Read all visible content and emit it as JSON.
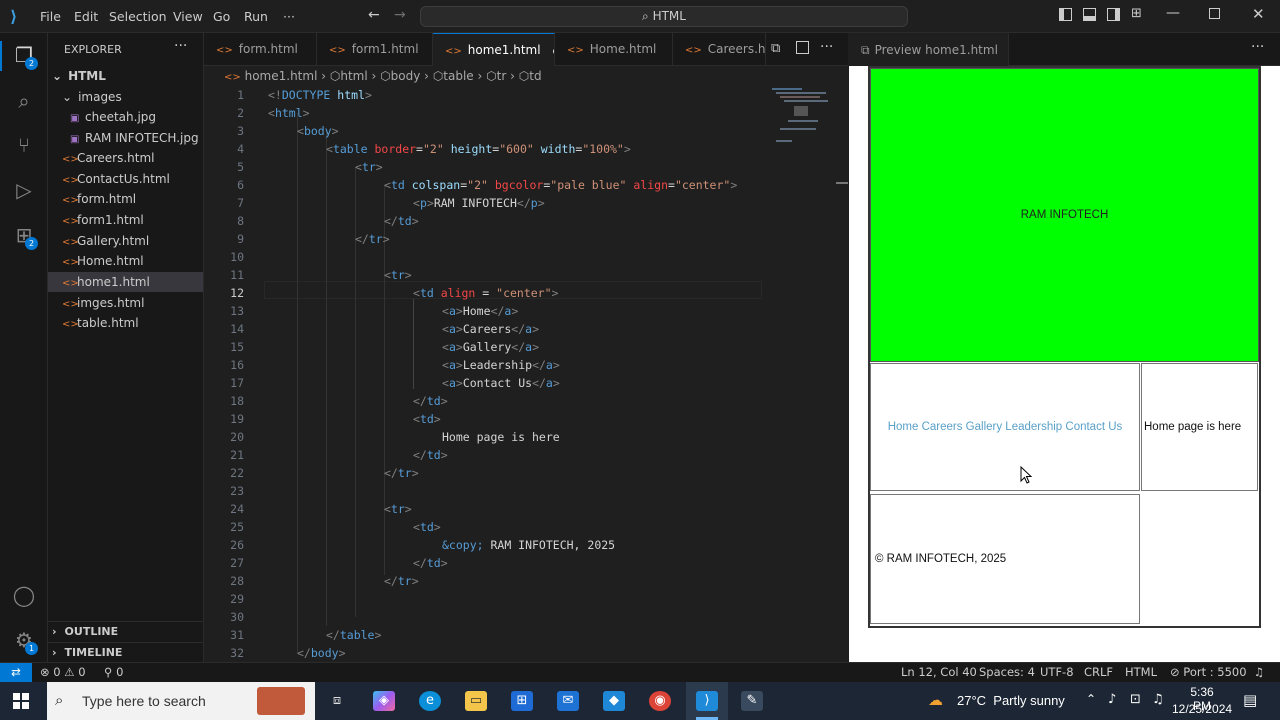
{
  "menu": [
    "File",
    "Edit",
    "Selection",
    "View",
    "Go",
    "Run",
    "···"
  ],
  "search_text": "HTML",
  "explorer": {
    "title": "EXPLORER",
    "root": "HTML",
    "items": [
      {
        "label": "images",
        "type": "folder"
      },
      {
        "label": "cheetah.jpg",
        "type": "image"
      },
      {
        "label": "RAM INFOTECH.jpg",
        "type": "image"
      },
      {
        "label": "Careers.html",
        "type": "html"
      },
      {
        "label": "ContactUs.html",
        "type": "html"
      },
      {
        "label": "form.html",
        "type": "html"
      },
      {
        "label": "form1.html",
        "type": "html"
      },
      {
        "label": "Gallery.html",
        "type": "html"
      },
      {
        "label": "Home.html",
        "type": "html"
      },
      {
        "label": "home1.html",
        "type": "html"
      },
      {
        "label": "imges.html",
        "type": "html"
      },
      {
        "label": "table.html",
        "type": "html"
      }
    ],
    "outline": "OUTLINE",
    "timeline": "TIMELINE"
  },
  "tabs": [
    "form.html",
    "form1.html",
    "home1.html",
    "Home.html",
    "Careers.htm"
  ],
  "breadcrumb": [
    "home1.html",
    "html",
    "body",
    "table",
    "tr",
    "td"
  ],
  "preview_tab": "Preview home1.html",
  "preview": {
    "title_text": "RAM INFOTECH",
    "nav_links": "Home Careers Gallery Leadership Contact Us",
    "content": "Home page is here",
    "footer": "© RAM INFOTECH, 2025",
    "banner_color": "#00ff00"
  },
  "status": {
    "errors": "0",
    "warnings": "0",
    "info": "0",
    "cursor": "Ln 12, Col 40",
    "spaces": "Spaces: 4",
    "encoding": "UTF-8",
    "eol": "CRLF",
    "language": "HTML",
    "port": "Port : 5500"
  },
  "taskbar": {
    "search_placeholder": "Type here to search",
    "weather": "27°C  Partly sunny",
    "time": "5:36 PM",
    "date": "12/25/2024"
  },
  "code_lines": [
    "1",
    "2",
    "3",
    "4",
    "5",
    "6",
    "7",
    "8",
    "9",
    "10",
    "11",
    "12",
    "13",
    "14",
    "15",
    "16",
    "17",
    "18",
    "19",
    "20",
    "21",
    "22",
    "23",
    "24",
    "25",
    "26",
    "27",
    "28",
    "29",
    "30",
    "31",
    "32"
  ],
  "code_text": {
    "l1": "DOCTYPE",
    "l1b": "html",
    "l4_border": "border",
    "l4_border_v": "\"2\"",
    "l4_height": "height",
    "l4_height_v": "\"600\"",
    "l4_width": "width",
    "l4_width_v": "\"100%\"",
    "l6_colspan": "colspan",
    "l6_colspan_v": "\"2\"",
    "l6_bgcolor": "bgcolor",
    "l6_bgcolor_v": "\"pale blue\"",
    "l6_align": "align",
    "l6_align_v": "\"center\"",
    "l7_text": "RAM INFOTECH",
    "l12_align": "align",
    "l12_align_v": "\"center\"",
    "l13": "Home",
    "l14": "Careers",
    "l15": "Gallery",
    "l16": "Leadership",
    "l17": "Contact Us",
    "l20": "Home page is here",
    "l26_entity": "&copy;",
    "l26_text": " RAM INFOTECH, 2025"
  }
}
